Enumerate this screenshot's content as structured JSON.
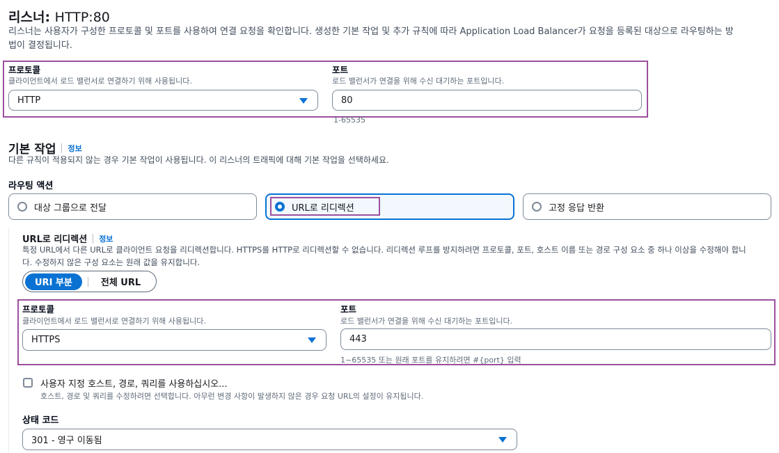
{
  "listener": {
    "title_prefix": "리스너:",
    "title_value": "HTTP:80",
    "description_line1": "리스너는 사용자가 구성한 프로토콜 및 포트를 사용하여 연결 요청을 확인합니다. 생성한 기본 작업 및 추가 규칙에 따라 Application Load Balancer가 요청을 등록된 대상으로 라우팅하는 방",
    "description_line2": "법이 결정됩니다.",
    "protocol_label": "프로토콜",
    "protocol_desc": "클라이언트에서 로드 밸런서로 연결하기 위해 사용됩니다.",
    "protocol_value": "HTTP",
    "port_label": "포트",
    "port_desc": "로드 밸런서가 연결을 위해 수신 대기하는 포트입니다.",
    "port_value": "80",
    "port_hint": "1-65535"
  },
  "default_action": {
    "title": "기본 작업",
    "info": "정보",
    "description": "다른 규칙이 적용되지 않는 경우 기본 작업이 사용됩니다. 이 리스너의 트래픽에 대해 기본 작업을 선택하세요.",
    "routing_label": "라우팅 액션",
    "options": [
      {
        "label": "대상 그룹으로 전달",
        "selected": false
      },
      {
        "label": "URL로 리디렉션",
        "selected": true
      },
      {
        "label": "고정 응답 반환",
        "selected": false
      }
    ]
  },
  "redirect": {
    "title": "URL로 리디렉션",
    "info": "정보",
    "description_line1": "특정 URL에서 다른 URL로 클라이언트 요청을 리디렉션합니다. HTTPS를 HTTP로 리디렉션할 수 없습니다. 리디렉션 루프를 방지하려면 프로토콜, 포트, 호스트 이름 또는 경로 구성 요소 중 하나 이상을 수정해야 합니",
    "description_line2": "다. 수정하지 않은 구성 요소는 원래 값을 유지합니다.",
    "segment_selected": "URI 부분",
    "segment_other": "전체 URL",
    "protocol_label": "프로토콜",
    "protocol_desc": "클라이언트에서 로드 밸런서로 연결하기 위해 사용됩니다.",
    "protocol_value": "HTTPS",
    "port_label": "포트",
    "port_desc": "로드 밸런서가 연결을 위해 수신 대기하는 포트입니다.",
    "port_value": "443",
    "port_hint": "1~65535 또는 원래 포트를 유지하려면 #{port} 입력",
    "custom_label": "사용자 지정 호스트, 경로, 쿼리를 사용하십시오...",
    "custom_desc": "호스트, 경로 및 쿼리를 수정하려면 선택합니다. 아무런 변경 사항이 발생하지 않은 경우 요청 URL의 설정이 유지됩니다.",
    "status_label": "상태 코드",
    "status_value": "301 - 영구 이동됨"
  },
  "colors": {
    "accent": "#0972d3",
    "highlight": "#9c4f9e"
  }
}
